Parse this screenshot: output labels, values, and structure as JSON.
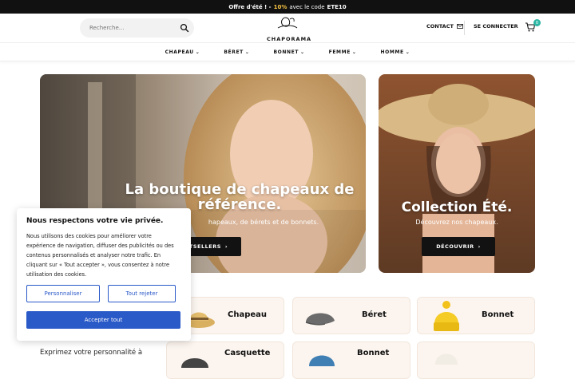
{
  "promo": {
    "part1": "Offre d'été ! -",
    "discount": "10%",
    "part2": "avec le code",
    "code": "ETE10"
  },
  "search": {
    "placeholder": "Recherche..."
  },
  "logo": {
    "brand": "CHAPORAMA"
  },
  "header": {
    "contact": "CONTACT",
    "signin": "SE CONNECTER",
    "cart_count": "0"
  },
  "nav": {
    "items": [
      {
        "label": "CHAPEAU"
      },
      {
        "label": "BÉRET"
      },
      {
        "label": "BONNET"
      },
      {
        "label": "FEMME"
      },
      {
        "label": "HOMME"
      }
    ]
  },
  "hero": {
    "title_line1": "La boutique de chapeaux de",
    "title_line2": "référence.",
    "subtitle": "hapeaux, de bérets et de bonnets.",
    "button": "TSELLERS"
  },
  "hero_side": {
    "title": "Collection Été.",
    "subtitle": "Découvrez nos chapeaux.",
    "button": "DÉCOUVRIR"
  },
  "categories": [
    {
      "label": "Chapeau"
    },
    {
      "label": "Béret"
    },
    {
      "label": "Bonnet"
    },
    {
      "label": "Casquette"
    },
    {
      "label": "Bonnet"
    }
  ],
  "cookie": {
    "title": "Nous respectons votre vie privée.",
    "text": "Nous utilisons des cookies pour améliorer votre expérience de navigation, diffuser des publicités ou des contenus personnalisés et analyser notre trafic. En cliquant sur « Tout accepter », vous consentez à notre utilisation des cookies.",
    "customize": "Personnaliser",
    "reject": "Tout rejeter",
    "accept": "Accepter tout"
  },
  "tagline": "Exprimez votre personnalité à",
  "colors": {
    "accent": "#2a59c8",
    "promo_highlight": "#f6c343",
    "badge": "#2bb5a3"
  }
}
